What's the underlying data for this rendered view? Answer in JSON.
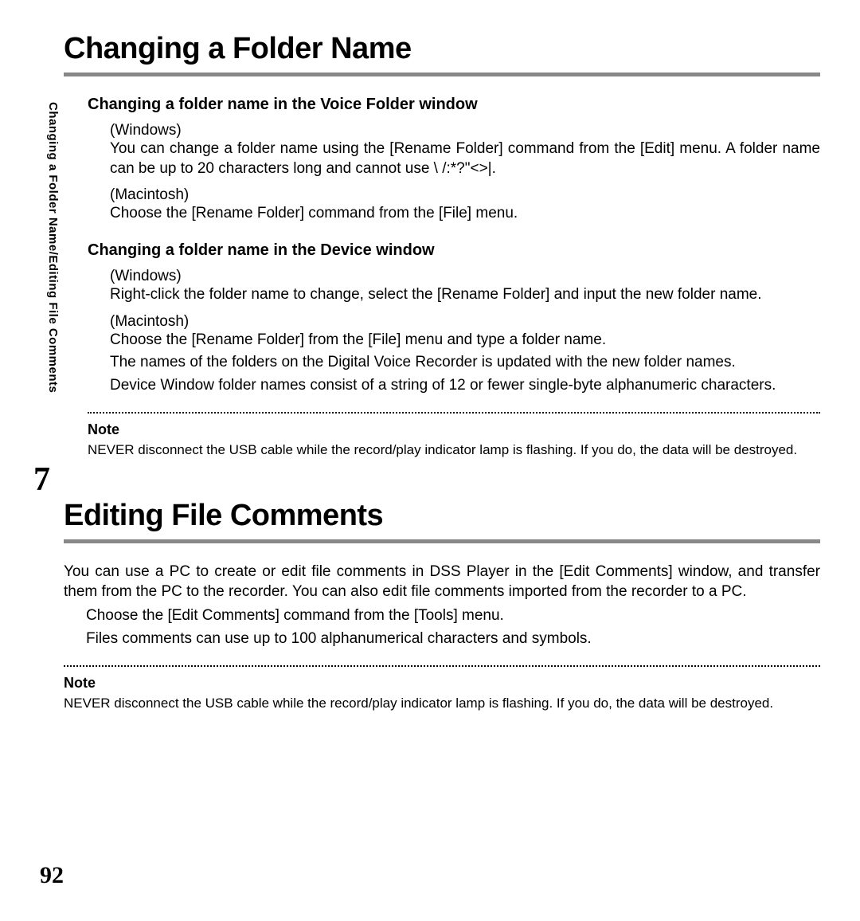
{
  "sidebar": {
    "running_head": "Changing a Folder Name/Editing File Comments"
  },
  "chapter_number": "7",
  "page_number": "92",
  "section1": {
    "title": "Changing a Folder Name",
    "sub1": {
      "heading": "Changing a folder name in the Voice Folder window",
      "win_label": "(Windows)",
      "win_text": "You can change a folder name using the [Rename Folder] command from the [Edit] menu. A folder name can be up to 20 characters long and cannot use \\ /:*?\"<>|.",
      "mac_label": "(Macintosh)",
      "mac_text": "Choose the [Rename Folder] command from the [File] menu."
    },
    "sub2": {
      "heading": "Changing a folder name in the Device window",
      "win_label": "(Windows)",
      "win_text": "Right-click the folder name to change, select the [Rename Folder] and input the new folder name.",
      "mac_label": "(Macintosh)",
      "mac_text1": "Choose the [Rename Folder] from the [File] menu and type a folder name.",
      "mac_text2": "The names of the folders on the Digital Voice Recorder is updated with the new folder names.",
      "mac_text3": "Device Window folder names consist of a string of 12 or fewer single-byte alphanumeric characters."
    },
    "note": {
      "label": "Note",
      "text": "NEVER disconnect the USB cable while the record/play indicator lamp is flashing. If you do, the data will be destroyed."
    }
  },
  "section2": {
    "title": "Editing File Comments",
    "body1": "You can use a PC to create or edit file comments in DSS Player in the [Edit Comments] window, and transfer them from the PC to the recorder. You can also edit file comments imported from the recorder to a PC.",
    "body2": "Choose the [Edit Comments] command from the [Tools] menu.",
    "body3": "Files comments can use up to 100 alphanumerical characters and symbols.",
    "note": {
      "label": "Note",
      "text": "NEVER disconnect the USB cable while the record/play indicator lamp is flashing. If you do, the data will be destroyed."
    }
  }
}
